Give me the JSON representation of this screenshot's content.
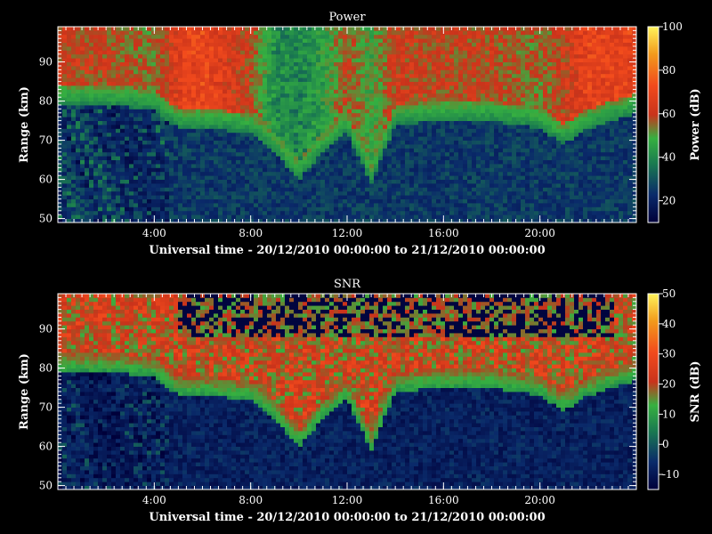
{
  "chart_data": [
    {
      "type": "heatmap",
      "title": "Power",
      "xlabel": "Universal time - 20/12/2010 00:00:00 to 21/12/2010 00:00:00",
      "ylabel": "Range (km)",
      "colorbar_label": "Power (dB)",
      "x_tick_labels": [
        "4:00",
        "8:00",
        "12:00",
        "16:00",
        "20:00"
      ],
      "x_ticks_hours": [
        4,
        8,
        12,
        16,
        20
      ],
      "xlim_hours": [
        0,
        24
      ],
      "y_ticks": [
        50,
        60,
        70,
        80,
        90
      ],
      "ylim": [
        49,
        99
      ],
      "colorbar_ticks": [
        20,
        40,
        60,
        80,
        100
      ],
      "clim": [
        10,
        100
      ],
      "colormap": [
        "#00003a",
        "#0a2a6a",
        "#1a7a50",
        "#36b040",
        "#c9331b",
        "#f24a1c",
        "#f29a1c",
        "#fff35a"
      ],
      "description_values": {
        "hours": [
          0,
          2,
          4,
          5,
          6,
          8,
          9,
          10,
          11,
          12,
          13,
          14,
          16,
          18,
          20,
          21,
          22,
          24
        ],
        "echo_lower_edge_km": [
          82,
          82,
          81,
          76,
          76,
          75,
          70,
          63,
          70,
          75,
          62,
          77,
          78,
          78,
          76,
          72,
          76,
          80
        ],
        "upper_power_db": [
          62,
          60,
          55,
          68,
          72,
          60,
          40,
          38,
          45,
          60,
          48,
          62,
          60,
          60,
          55,
          62,
          70,
          70
        ],
        "background_db": 25
      }
    },
    {
      "type": "heatmap",
      "title": "SNR",
      "xlabel": "Universal time - 20/12/2010 00:00:00 to 21/12/2010 00:00:00",
      "ylabel": "Range (km)",
      "colorbar_label": "SNR (dB)",
      "x_tick_labels": [
        "4:00",
        "8:00",
        "12:00",
        "16:00",
        "20:00"
      ],
      "x_ticks_hours": [
        4,
        8,
        12,
        16,
        20
      ],
      "xlim_hours": [
        0,
        24
      ],
      "y_ticks": [
        50,
        60,
        70,
        80,
        90
      ],
      "ylim": [
        49,
        99
      ],
      "colorbar_ticks": [
        -10,
        0,
        10,
        20,
        30,
        40,
        50
      ],
      "clim": [
        -15,
        50
      ],
      "colormap": [
        "#00003a",
        "#0a2a6a",
        "#1a7a50",
        "#36b040",
        "#c9331b",
        "#f24a1c",
        "#f29a1c",
        "#fff35a"
      ]
    }
  ]
}
